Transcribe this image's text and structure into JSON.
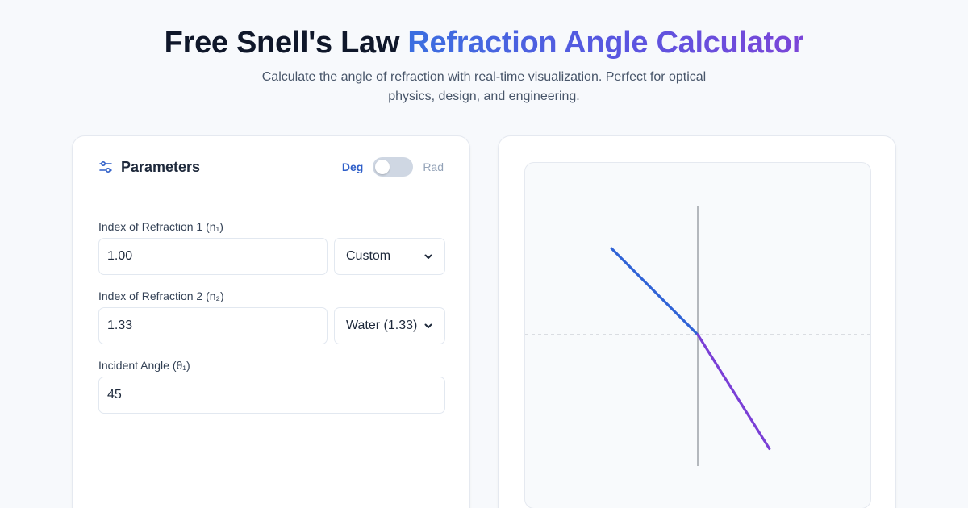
{
  "header": {
    "title_plain": "Free Snell's Law ",
    "title_accent": "Refraction Angle Calculator",
    "subtitle": "Calculate the angle of refraction with real-time visualization. Perfect for optical physics, design, and engineering."
  },
  "parameters": {
    "title": "Parameters",
    "icon": "sliders-icon",
    "unit_toggle": {
      "left": "Deg",
      "right": "Rad",
      "selected": "Deg"
    },
    "n1": {
      "label": "Index of Refraction 1 (n₁)",
      "value": "1.00",
      "preset": "Custom"
    },
    "n2": {
      "label": "Index of Refraction 2 (n₂)",
      "value": "1.33",
      "preset": "Water (1.33)"
    },
    "theta1": {
      "label": "Incident Angle (θ₁)",
      "value": "45"
    }
  },
  "visualization": {
    "incident_angle_deg": 45,
    "n1": 1.0,
    "n2": 1.33,
    "colors": {
      "incident_ray": "#2f62d6",
      "refracted_ray": "#7a3fd6",
      "normal_line": "#a3a7ad",
      "interface_line": "#c7ccd3"
    }
  },
  "colors": {
    "accent_gradient_start": "#3b6fe0",
    "accent_gradient_end": "#7b46d8",
    "toggle_active": "#2f5fc9"
  }
}
